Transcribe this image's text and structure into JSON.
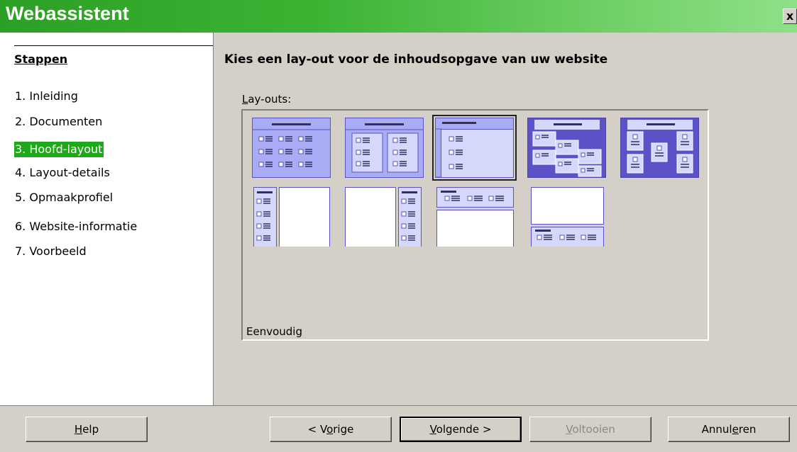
{
  "window": {
    "title": "Webassistent",
    "close_label": "x"
  },
  "sidebar": {
    "title": "Stappen",
    "steps": [
      {
        "label": "1. Inleiding"
      },
      {
        "label": "2. Documenten"
      },
      {
        "label": "3. Hoofd-layout",
        "active": true
      },
      {
        "label": "4. Layout-details"
      },
      {
        "label": "5. Opmaakprofiel"
      },
      {
        "label": "6. Website-informatie"
      },
      {
        "label": "7. Voorbeeld"
      }
    ]
  },
  "main": {
    "heading": "Kies een lay-out voor de inhoudsopgave van uw website",
    "layouts_label": "Lay-outs:",
    "selected_caption": "Eenvoudig",
    "layouts": [
      {
        "icon": "layout-table-3col-icon"
      },
      {
        "icon": "layout-table-2col-icon"
      },
      {
        "icon": "layout-simple-list-icon",
        "selected": true
      },
      {
        "icon": "layout-diagonal-icon"
      },
      {
        "icon": "layout-zigzag-icon"
      },
      {
        "icon": "layout-frame-left-icon"
      },
      {
        "icon": "layout-frame-right-icon"
      },
      {
        "icon": "layout-frame-top-icon"
      },
      {
        "icon": "layout-frame-bottom-icon"
      }
    ]
  },
  "buttons": {
    "help": {
      "label": "Help",
      "mnemonic": "H"
    },
    "back": {
      "label": "< Vorige",
      "mnemonic": "o"
    },
    "next": {
      "label": "Volgende >",
      "mnemonic": "V"
    },
    "finish": {
      "label": "Voltooien",
      "mnemonic": "V",
      "disabled": true
    },
    "cancel": {
      "label": "Annuleren",
      "mnemonic": "e"
    }
  },
  "colors": {
    "title_gradient_start": "#2ca024",
    "title_gradient_end": "#8fe089",
    "active_step": "#1ea81a",
    "thumb_light": "#a8acf5",
    "thumb_dark": "#5a52c6"
  }
}
